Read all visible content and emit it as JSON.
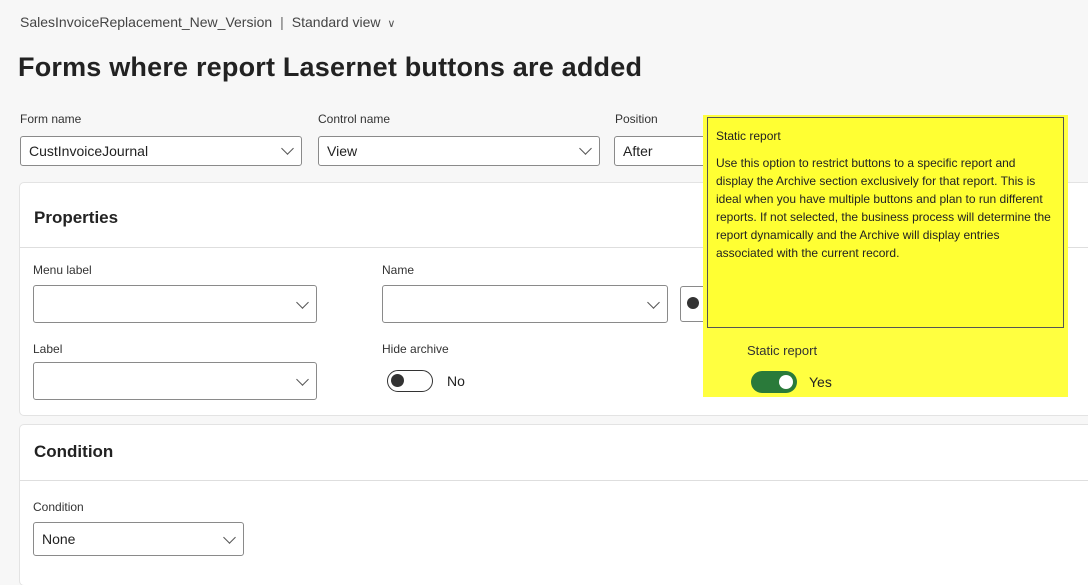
{
  "breadcrumb": {
    "record": "SalesInvoiceReplacement_New_Version",
    "separator": "|",
    "view": "Standard view"
  },
  "page_title": "Forms where report Lasernet buttons are added",
  "top_fields": {
    "form_name": {
      "label": "Form name",
      "value": "CustInvoiceJournal"
    },
    "control_name": {
      "label": "Control name",
      "value": "View"
    },
    "position": {
      "label": "Position",
      "value": "After"
    }
  },
  "properties": {
    "header": "Properties",
    "menu_label": {
      "label": "Menu label",
      "value": ""
    },
    "name": {
      "label": "Name",
      "value": ""
    },
    "label": {
      "label": "Label",
      "value": ""
    },
    "hide_archive": {
      "label": "Hide archive",
      "value": "No",
      "on": false
    },
    "static_report": {
      "label": "Static report",
      "value": "Yes",
      "on": true
    }
  },
  "condition": {
    "header": "Condition",
    "field": {
      "label": "Condition",
      "value": "None"
    }
  },
  "tooltip": {
    "title": "Static report",
    "body": "Use this option to restrict buttons to a specific report and display the Archive section exclusively for that report. This is ideal when you have multiple buttons and plan to run different reports. If not selected, the business process will determine the report dynamically and the Archive will display entries associated with the current record."
  },
  "colors": {
    "highlight": "#ffff40",
    "toggle_on": "#2a7a3a"
  }
}
